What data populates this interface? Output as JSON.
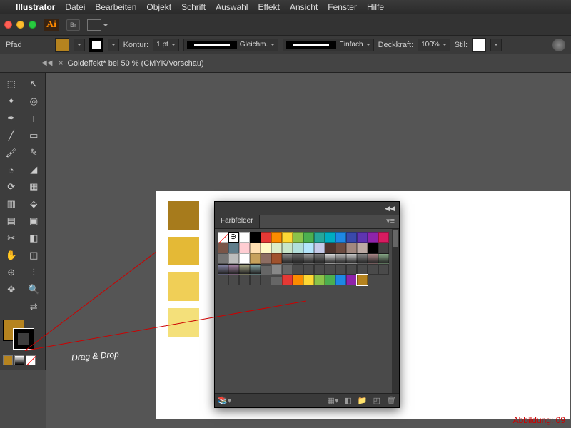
{
  "menubar": {
    "apple": "",
    "app": "Illustrator",
    "items": [
      "Datei",
      "Bearbeiten",
      "Objekt",
      "Schrift",
      "Auswahl",
      "Effekt",
      "Ansicht",
      "Fenster",
      "Hilfe"
    ]
  },
  "titlebar": {
    "ai": "Ai",
    "br": "Br"
  },
  "controlbar": {
    "object_type": "Pfad",
    "kontur_label": "Kontur:",
    "kontur_value": "1 pt",
    "profile_label": "Gleichm.",
    "brush_label": "Einfach",
    "opacity_label": "Deckkraft:",
    "opacity_value": "100%",
    "stil_label": "Stil:"
  },
  "document": {
    "tab": "Goldeffekt* bei 50 % (CMYK/Vorschau)"
  },
  "panel": {
    "title": "Farbfelder"
  },
  "swatches": {
    "row1": [
      "#ffffff",
      "#000000",
      "#e53935",
      "#fb8c00",
      "#fdd835",
      "#8bc34a",
      "#4caf50",
      "#26a69a",
      "#00acc1",
      "#1e88e5",
      "#3949ab",
      "#5e35b1"
    ],
    "row2": [
      "#8e24aa",
      "#d81b60",
      "#795548",
      "#607d8b",
      "#ffcdd2",
      "#ffe0b2",
      "#fff9c4",
      "#dcedc8",
      "#c8e6c9",
      "#b2dfdb",
      "#b3e5fc",
      "#c5cae9"
    ],
    "row3": [
      "#4e342e",
      "#6d4c41",
      "#a1887f",
      "#bcaaa4",
      "#000000",
      "#424242",
      "#757575",
      "#bdbdbd",
      "#ffffff",
      "#c6a15c",
      "#8d6e63",
      "#a0522d"
    ],
    "row4_colors": [
      "#e53935",
      "#fb8c00",
      "#fdd835",
      "#8bc34a",
      "#4caf50",
      "#1e88e5",
      "#8e24aa",
      "#b5831f"
    ],
    "gold_samples": [
      "#a77b1c",
      "#e4b936",
      "#f0cf57",
      "#f4e07a"
    ]
  },
  "annotation": {
    "text": "Drag & Drop"
  },
  "caption": "Abbildung: 09",
  "tools": [
    [
      "⬚",
      "↖"
    ],
    [
      "✦",
      "◎"
    ],
    [
      "✒",
      "T"
    ],
    [
      "╱",
      "▭"
    ],
    [
      "🖌",
      "✎"
    ],
    [
      "◔",
      "◢"
    ],
    [
      "⟳",
      "▦"
    ],
    [
      "▥",
      "⬙"
    ],
    [
      "▤",
      "▣"
    ],
    [
      "✂",
      "◧"
    ],
    [
      "✋",
      "◫"
    ],
    [
      "⊕",
      "⫶"
    ],
    [
      "✥",
      "🔍"
    ],
    [
      " ",
      "⇄"
    ]
  ]
}
